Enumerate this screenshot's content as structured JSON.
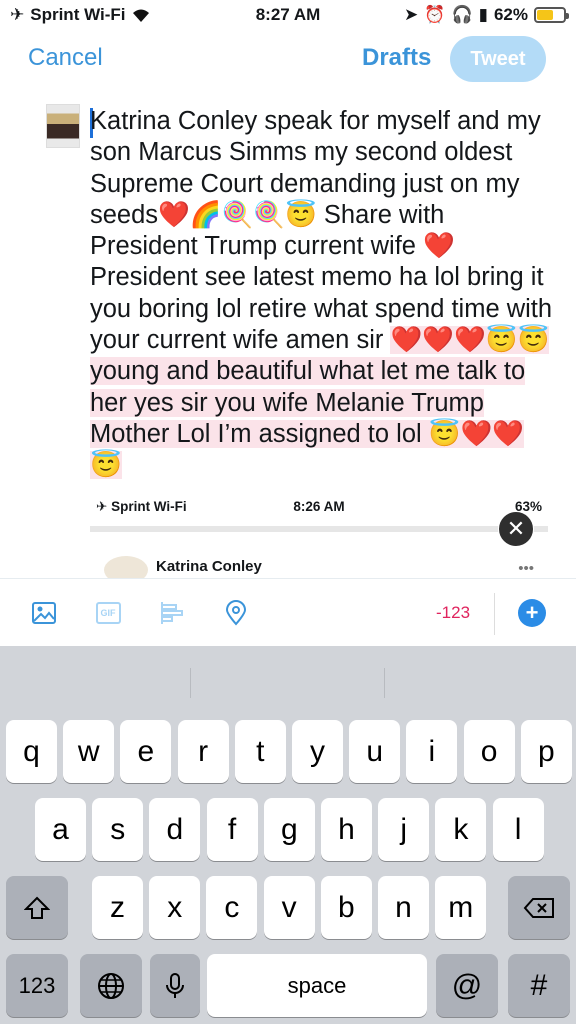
{
  "status_bar": {
    "carrier": "Sprint Wi-Fi",
    "time": "8:27 AM",
    "battery": "62%",
    "battery_level": 0.62
  },
  "nav": {
    "cancel": "Cancel",
    "drafts": "Drafts",
    "tweet": "Tweet"
  },
  "compose": {
    "text_plain": "Katrina Conley speak for myself and my son Marcus Simms my second oldest Supreme Court demanding just on my seeds❤️🌈🍭🍭😇 Share with President Trump current wife ❤️ President see latest memo ha lol bring it you boring lol retire what spend time with your current wife amen sir ",
    "text_highlighted": "❤️❤️❤️😇😇young and beautiful what let me talk to her yes sir you wife Melanie Trump Mother Lol I’m assigned to lol 😇❤️❤️😇"
  },
  "attachment": {
    "carrier": "Sprint Wi-Fi",
    "time": "8:26 AM",
    "battery": "63%",
    "author": "Katrina Conley",
    "more": "•••"
  },
  "toolbar": {
    "icons": [
      "image-icon",
      "gif-icon",
      "poll-icon",
      "location-icon"
    ],
    "gif_label": "GIF",
    "counter": "-123",
    "add_label": "+"
  },
  "keyboard": {
    "row1": [
      "q",
      "w",
      "e",
      "r",
      "t",
      "y",
      "u",
      "i",
      "o",
      "p"
    ],
    "row2": [
      "a",
      "s",
      "d",
      "f",
      "g",
      "h",
      "j",
      "k",
      "l"
    ],
    "row3": [
      "z",
      "x",
      "c",
      "v",
      "b",
      "n",
      "m"
    ],
    "numbers": "123",
    "space": "space",
    "at": "@",
    "hash": "#"
  }
}
